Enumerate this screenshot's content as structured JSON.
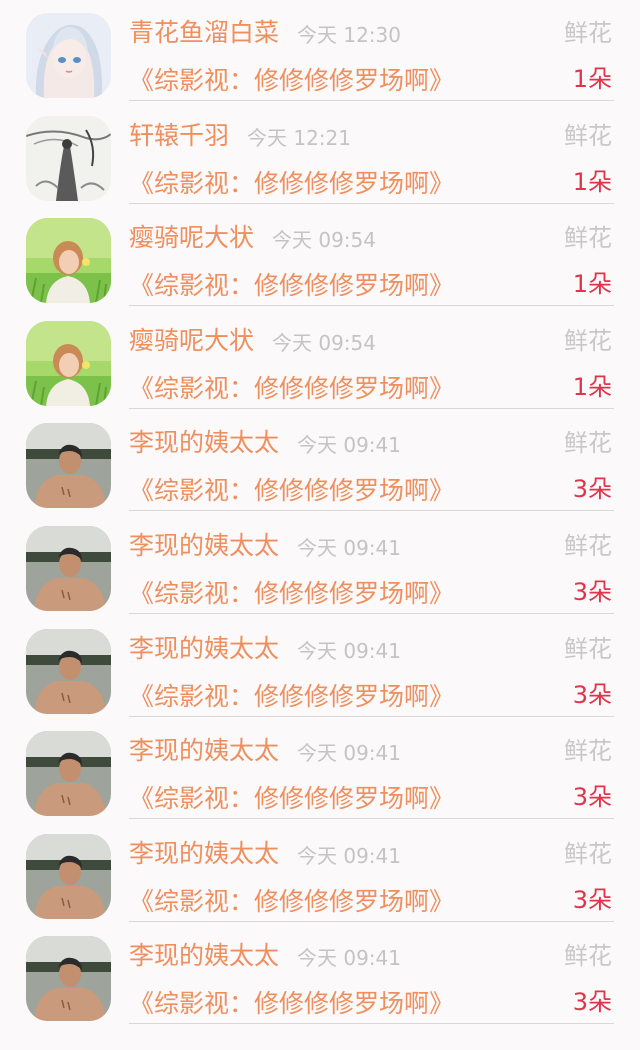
{
  "rows": [
    {
      "avatar": "anime-elf-avatar",
      "name": "青花鱼溜白菜",
      "time": "今天 12:30",
      "gift": "鲜花",
      "book": "《综影视：修修修修罗场啊》",
      "count": "1朵"
    },
    {
      "avatar": "ink-painting-avatar",
      "name": "轩辕千羽",
      "time": "今天 12:21",
      "gift": "鲜花",
      "book": "《综影视：修修修修罗场啊》",
      "count": "1朵"
    },
    {
      "avatar": "girl-in-grass-avatar",
      "name": "瘿骑呢大状",
      "time": "今天 09:54",
      "gift": "鲜花",
      "book": "《综影视：修修修修罗场啊》",
      "count": "1朵"
    },
    {
      "avatar": "girl-in-grass-avatar",
      "name": "瘿骑呢大状",
      "time": "今天 09:54",
      "gift": "鲜花",
      "book": "《综影视：修修修修罗场啊》",
      "count": "1朵"
    },
    {
      "avatar": "man-portrait-avatar",
      "name": "李现的姨太太",
      "time": "今天 09:41",
      "gift": "鲜花",
      "book": "《综影视：修修修修罗场啊》",
      "count": "3朵"
    },
    {
      "avatar": "man-portrait-avatar",
      "name": "李现的姨太太",
      "time": "今天 09:41",
      "gift": "鲜花",
      "book": "《综影视：修修修修罗场啊》",
      "count": "3朵"
    },
    {
      "avatar": "man-portrait-avatar",
      "name": "李现的姨太太",
      "time": "今天 09:41",
      "gift": "鲜花",
      "book": "《综影视：修修修修罗场啊》",
      "count": "3朵"
    },
    {
      "avatar": "man-portrait-avatar",
      "name": "李现的姨太太",
      "time": "今天 09:41",
      "gift": "鲜花",
      "book": "《综影视：修修修修罗场啊》",
      "count": "3朵"
    },
    {
      "avatar": "man-portrait-avatar",
      "name": "李现的姨太太",
      "time": "今天 09:41",
      "gift": "鲜花",
      "book": "《综影视：修修修修罗场啊》",
      "count": "3朵"
    },
    {
      "avatar": "man-portrait-avatar",
      "name": "李现的姨太太",
      "time": "今天 09:41",
      "gift": "鲜花",
      "book": "《综影视：修修修修罗场啊》",
      "count": "3朵"
    }
  ],
  "colors": {
    "accent": "#ef8f5e",
    "count": "#e0344a",
    "muted": "#c4c4c4",
    "background": "#fbf9fa"
  }
}
